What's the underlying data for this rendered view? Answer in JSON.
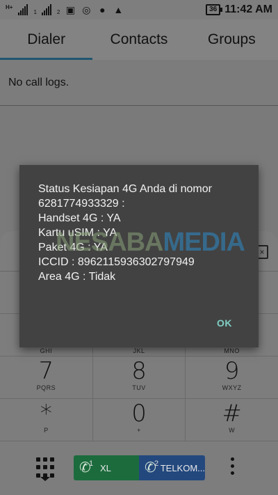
{
  "status_bar": {
    "network_label": "H+",
    "sim1_sub": "1",
    "sim2_sub": "2",
    "battery": "36",
    "time": "11:42 AM",
    "icons": [
      "signal-icon",
      "signal-icon",
      "image-icon",
      "hotspot-icon",
      "chat-icon",
      "warning-icon",
      "battery-icon"
    ]
  },
  "tabs": [
    {
      "label": "Dialer",
      "active": true
    },
    {
      "label": "Contacts",
      "active": false
    },
    {
      "label": "Groups",
      "active": false
    }
  ],
  "call_log": {
    "empty_text": "No call logs."
  },
  "keypad": {
    "partial_letters": [
      "GHI",
      "JKL",
      "MNO"
    ],
    "rows": [
      [
        {
          "digit": "7",
          "letters": "PQRS"
        },
        {
          "digit": "8",
          "letters": "TUV"
        },
        {
          "digit": "9",
          "letters": "WXYZ"
        }
      ],
      [
        {
          "digit": "*",
          "letters": "P"
        },
        {
          "digit": "0",
          "letters": "+"
        },
        {
          "digit": "#",
          "letters": "W"
        }
      ]
    ]
  },
  "bottom_bar": {
    "sim1_slot": "1",
    "sim1_label": "XL",
    "sim2_slot": "2",
    "sim2_label": "TELKOM...",
    "colors": {
      "sim1": "#1c6b3d",
      "sim2": "#23487e"
    }
  },
  "dialog": {
    "message": "Status Kesiapan 4G Anda di nomor\n6281774933329 :\nHandset 4G : YA\nKartu uSIM : YA\nPaket 4G : YA\nICCID : 8962115936302797949\nArea 4G : Tidak",
    "ok_label": "OK"
  },
  "watermark": {
    "part1": "NESABA",
    "part2": "MEDIA"
  }
}
